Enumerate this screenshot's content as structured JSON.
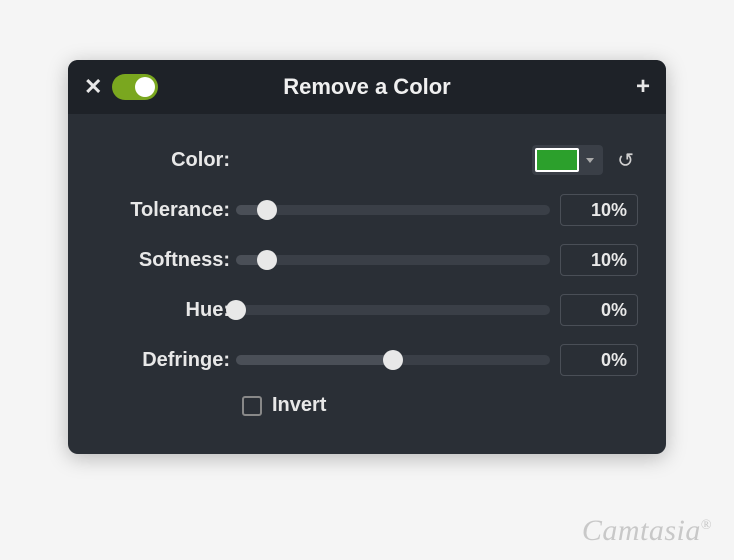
{
  "header": {
    "title": "Remove a Color",
    "toggle_on": true
  },
  "rows": {
    "color": {
      "label": "Color:",
      "swatch": "#2ca02c"
    },
    "tolerance": {
      "label": "Tolerance:",
      "value": "10%",
      "percent": 10
    },
    "softness": {
      "label": "Softness:",
      "value": "10%",
      "percent": 10
    },
    "hue": {
      "label": "Hue:",
      "value": "0%",
      "percent": 0
    },
    "defringe": {
      "label": "Defringe:",
      "value": "0%",
      "percent": 50
    }
  },
  "invert": {
    "label": "Invert",
    "checked": false
  },
  "watermark": "Camtasia"
}
